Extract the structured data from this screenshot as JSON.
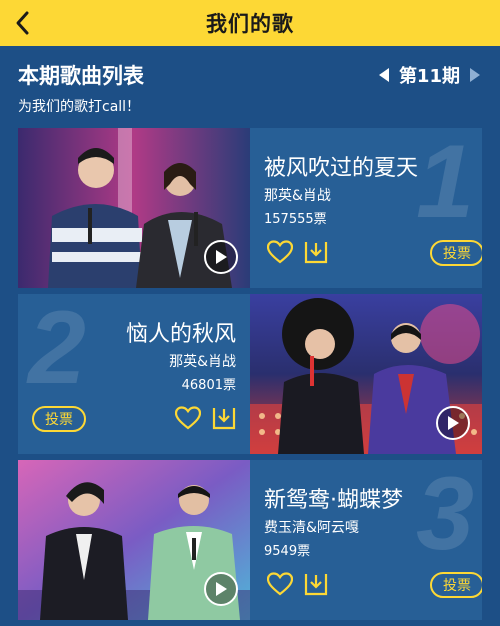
{
  "header": {
    "title": "我们的歌"
  },
  "list": {
    "title": "本期歌曲列表",
    "period_label": "第11期",
    "subtitle": "为我们的歌打call！"
  },
  "songs": [
    {
      "number": "1",
      "title": "被风吹过的夏天",
      "singer": "那英&肖战",
      "votes": "157555票",
      "vote_label": "投票"
    },
    {
      "number": "2",
      "title": "恼人的秋风",
      "singer": "那英&肖战",
      "votes": "46801票",
      "vote_label": "投票"
    },
    {
      "number": "3",
      "title": "新鸳鸯·蝴蝶梦",
      "singer": "费玉清&阿云嘎",
      "votes": "9549票",
      "vote_label": "投票"
    }
  ],
  "icons": {
    "back": "back-chevron-icon",
    "prev": "prev-triangle-icon",
    "next": "next-triangle-icon",
    "like": "heart-icon",
    "download": "download-icon",
    "play": "play-icon"
  },
  "colors": {
    "accent": "#fdd835",
    "background": "#1d4f86",
    "card": "#275f96"
  }
}
